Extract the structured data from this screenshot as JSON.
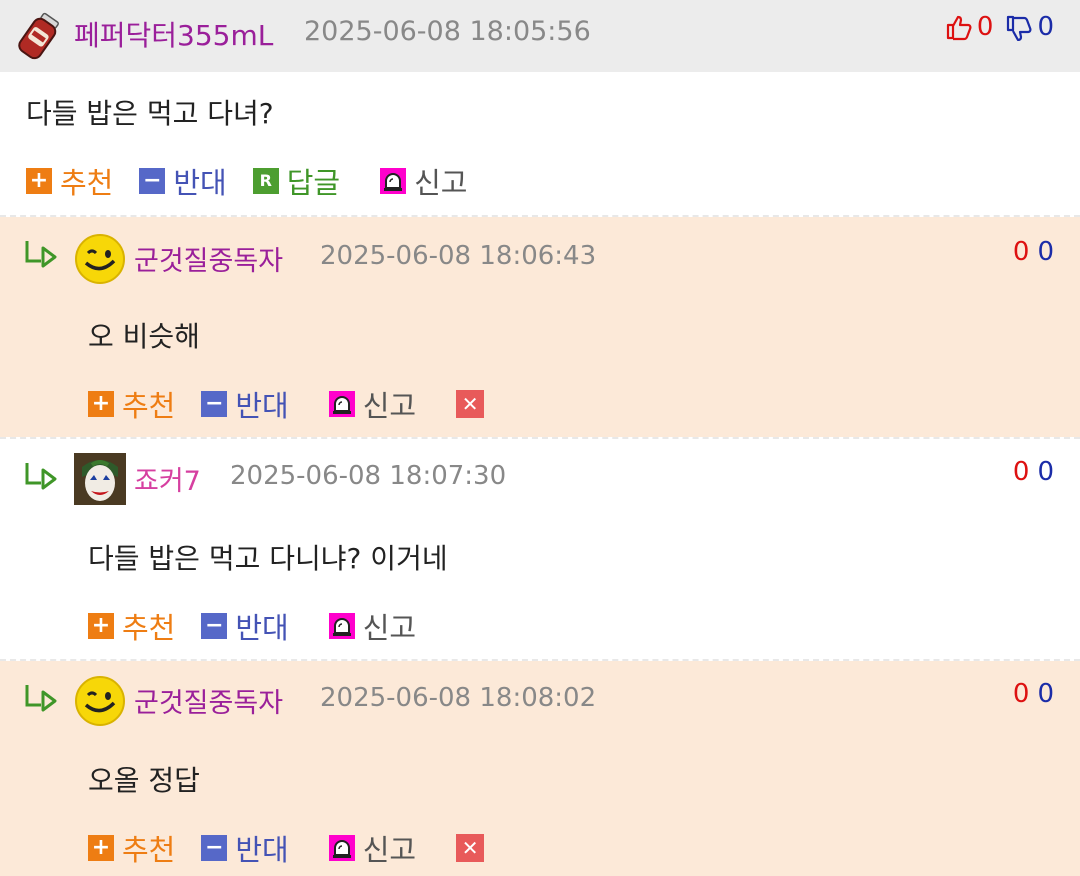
{
  "post": {
    "author": "페퍼닥터355mL",
    "timestamp": "2025-06-08 18:05:56",
    "up_count": "0",
    "down_count": "0",
    "text": "다들 밥은 먹고 다녀?",
    "actions": {
      "recommend": "추천",
      "oppose": "반대",
      "reply": "답글",
      "reply_icon_letter": "R",
      "report": "신고"
    }
  },
  "comments": [
    {
      "author": "군것질중독자",
      "author_color": "#9a1f9a",
      "timestamp": "2025-06-08 18:06:43",
      "up_count": "0",
      "down_count": "0",
      "text": "오 비슷해",
      "avatar_icon": "wink-smiley-icon",
      "actions": {
        "recommend": "추천",
        "oppose": "반대",
        "report": "신고"
      },
      "has_delete": true
    },
    {
      "author": "죠커7",
      "author_color": "#d63fa0",
      "timestamp": "2025-06-08 18:07:30",
      "up_count": "0",
      "down_count": "0",
      "text": "다들 밥은 먹고 다니냐? 이거네",
      "avatar_icon": "joker-face-icon",
      "actions": {
        "recommend": "추천",
        "oppose": "반대",
        "report": "신고"
      },
      "has_delete": false
    },
    {
      "author": "군것질중독자",
      "author_color": "#9a1f9a",
      "timestamp": "2025-06-08 18:08:02",
      "up_count": "0",
      "down_count": "0",
      "text": "오올 정답",
      "avatar_icon": "wink-smiley-icon",
      "actions": {
        "recommend": "추천",
        "oppose": "반대",
        "report": "신고"
      },
      "has_delete": true
    }
  ],
  "colors": {
    "header_bg": "#ececec",
    "tinted_comment_bg": "#fce9d8",
    "up_vote": "#dd1111",
    "down_vote": "#1b2ca8",
    "recommend": "#ee7d13",
    "oppose": "#4453b5",
    "reply": "#3f9628",
    "report_icon": "#ff00cc",
    "delete_icon": "#e85a5a"
  }
}
